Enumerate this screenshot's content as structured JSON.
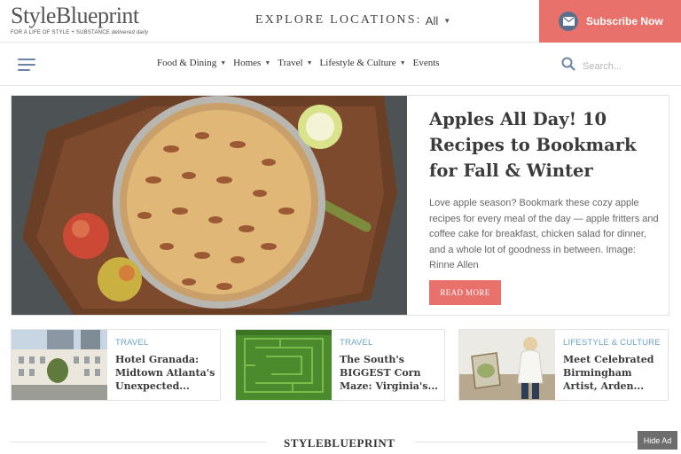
{
  "header": {
    "logo_text": "StyleBlueprint",
    "logo_tagline": "FOR A LIFE OF STYLE + SUBSTANCE",
    "logo_tagline_em": "delivered daily",
    "explore_label": "EXPLORE LOCATIONS:",
    "explore_value": "All",
    "subscribe_label": "Subscribe Now"
  },
  "nav": {
    "items": [
      {
        "label": "Food & Dining",
        "has_dropdown": true
      },
      {
        "label": "Homes",
        "has_dropdown": true
      },
      {
        "label": "Travel",
        "has_dropdown": true
      },
      {
        "label": "Lifestyle & Culture",
        "has_dropdown": true
      },
      {
        "label": "Events",
        "has_dropdown": false
      }
    ],
    "search_placeholder": "Search..."
  },
  "hero": {
    "title": "Apples All Day! 10 Recipes to Bookmark for Fall & Winter",
    "description": "Love apple season? Bookmark these cozy apple recipes for every meal of the day — apple fritters and coffee cake for breakfast, chicken salad for dinner, and a whole lot of goodness in between. Image: Rinne Allen",
    "cta_label": "READ MORE"
  },
  "cards": [
    {
      "category": "TRAVEL",
      "title": "Hotel Granada: Midtown Atlanta's Unexpected..."
    },
    {
      "category": "TRAVEL",
      "title": "The South's BIGGEST Corn Maze: Virginia's..."
    },
    {
      "category": "LIFESTYLE & CULTURE",
      "title": "Meet Celebrated Birmingham Artist, Arden..."
    }
  ],
  "footer": {
    "logo_text": "STYLEBLUEPRINT",
    "hide_ad_label": "Hide Ad"
  },
  "colors": {
    "accent": "#e8726b",
    "category": "#6ba3c9",
    "nav_icon": "#6b84a8"
  }
}
